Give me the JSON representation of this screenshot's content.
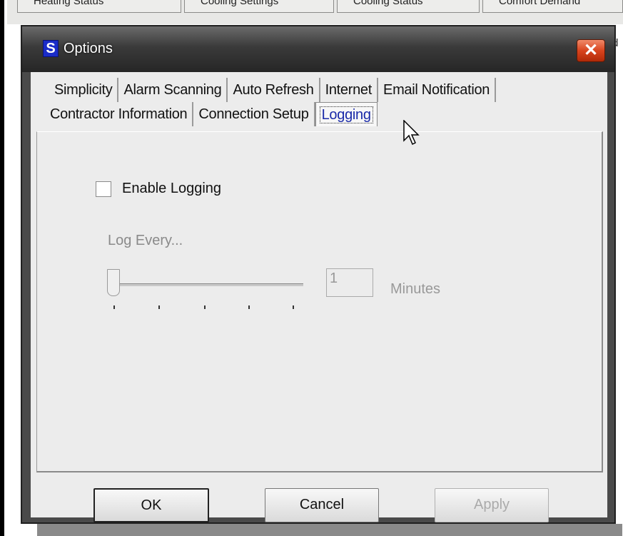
{
  "background": {
    "tabs": [
      "Heating Status",
      "Cooling Settings",
      "Cooling Status",
      "Comfort Demand"
    ],
    "right_fragment": "d"
  },
  "dialog": {
    "title": "Options",
    "icon_letter": "S",
    "close_glyph": "✕"
  },
  "tabs": {
    "row1": [
      "Simplicity",
      "Alarm Scanning",
      "Auto Refresh",
      "Internet",
      "Email Notification"
    ],
    "row2": [
      "Contractor Information",
      "Connection Setup",
      "Logging"
    ],
    "active": "Logging"
  },
  "logging": {
    "enable_label": "Enable Logging",
    "enable_checked": false,
    "log_every_label": "Log Every...",
    "slider_value": 1,
    "interval_value": "1",
    "interval_unit": "Minutes"
  },
  "buttons": {
    "ok": "OK",
    "cancel": "Cancel",
    "apply": "Apply"
  },
  "colors": {
    "titlebar": "#2a2a2a",
    "close": "#d8441e",
    "app_icon": "#1a2cc8",
    "active_tab_text": "#1a2aa8"
  }
}
